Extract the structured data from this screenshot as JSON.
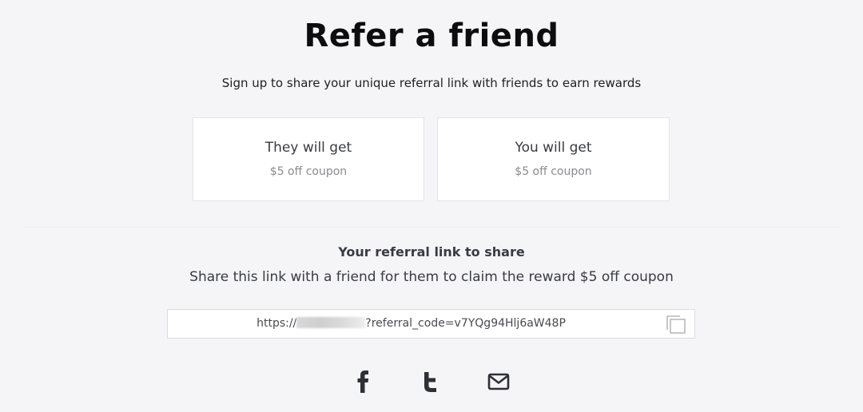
{
  "header": {
    "title": "Refer a friend",
    "subtitle": "Sign up to share your unique referral link with friends to earn rewards"
  },
  "rewards": [
    {
      "heading": "They will get",
      "value": "$5 off coupon"
    },
    {
      "heading": "You will get",
      "value": "$5 off coupon"
    }
  ],
  "referral": {
    "heading": "Your referral link to share",
    "description": "Share this link with a friend for them to claim the reward $5 off coupon",
    "link_prefix": "https://",
    "link_suffix": "?referral_code=v7YQg94Hlj6aW48P",
    "copy_icon": "copy-icon"
  },
  "share": {
    "icons": [
      "facebook-icon",
      "twitter-icon",
      "email-icon"
    ]
  },
  "colors": {
    "background": "#f5f5f7",
    "card": "#ffffff",
    "text_dark": "#0d0d0d",
    "text_muted": "#8a8a90"
  }
}
